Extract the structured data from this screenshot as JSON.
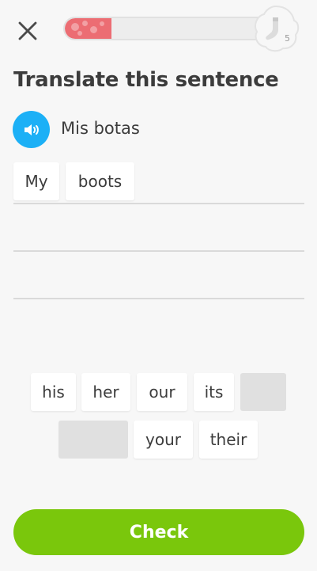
{
  "header": {
    "close_icon": "close-icon",
    "progress_fraction": 0.23,
    "reward_icon": "sock-icon",
    "reward_count": "5"
  },
  "lesson": {
    "title": "Translate this sentence",
    "speaker_icon": "speaker-icon",
    "prompt": "Mis botas"
  },
  "answer": {
    "selected_words": [
      "My",
      "boots"
    ]
  },
  "word_bank": {
    "words": [
      "his",
      "her",
      "our",
      "its",
      "your",
      "their"
    ]
  },
  "footer": {
    "check_label": "Check"
  },
  "colors": {
    "accent_blue": "#1cb0f6",
    "progress_red": "#ec6d73",
    "check_green": "#7ac70c"
  }
}
